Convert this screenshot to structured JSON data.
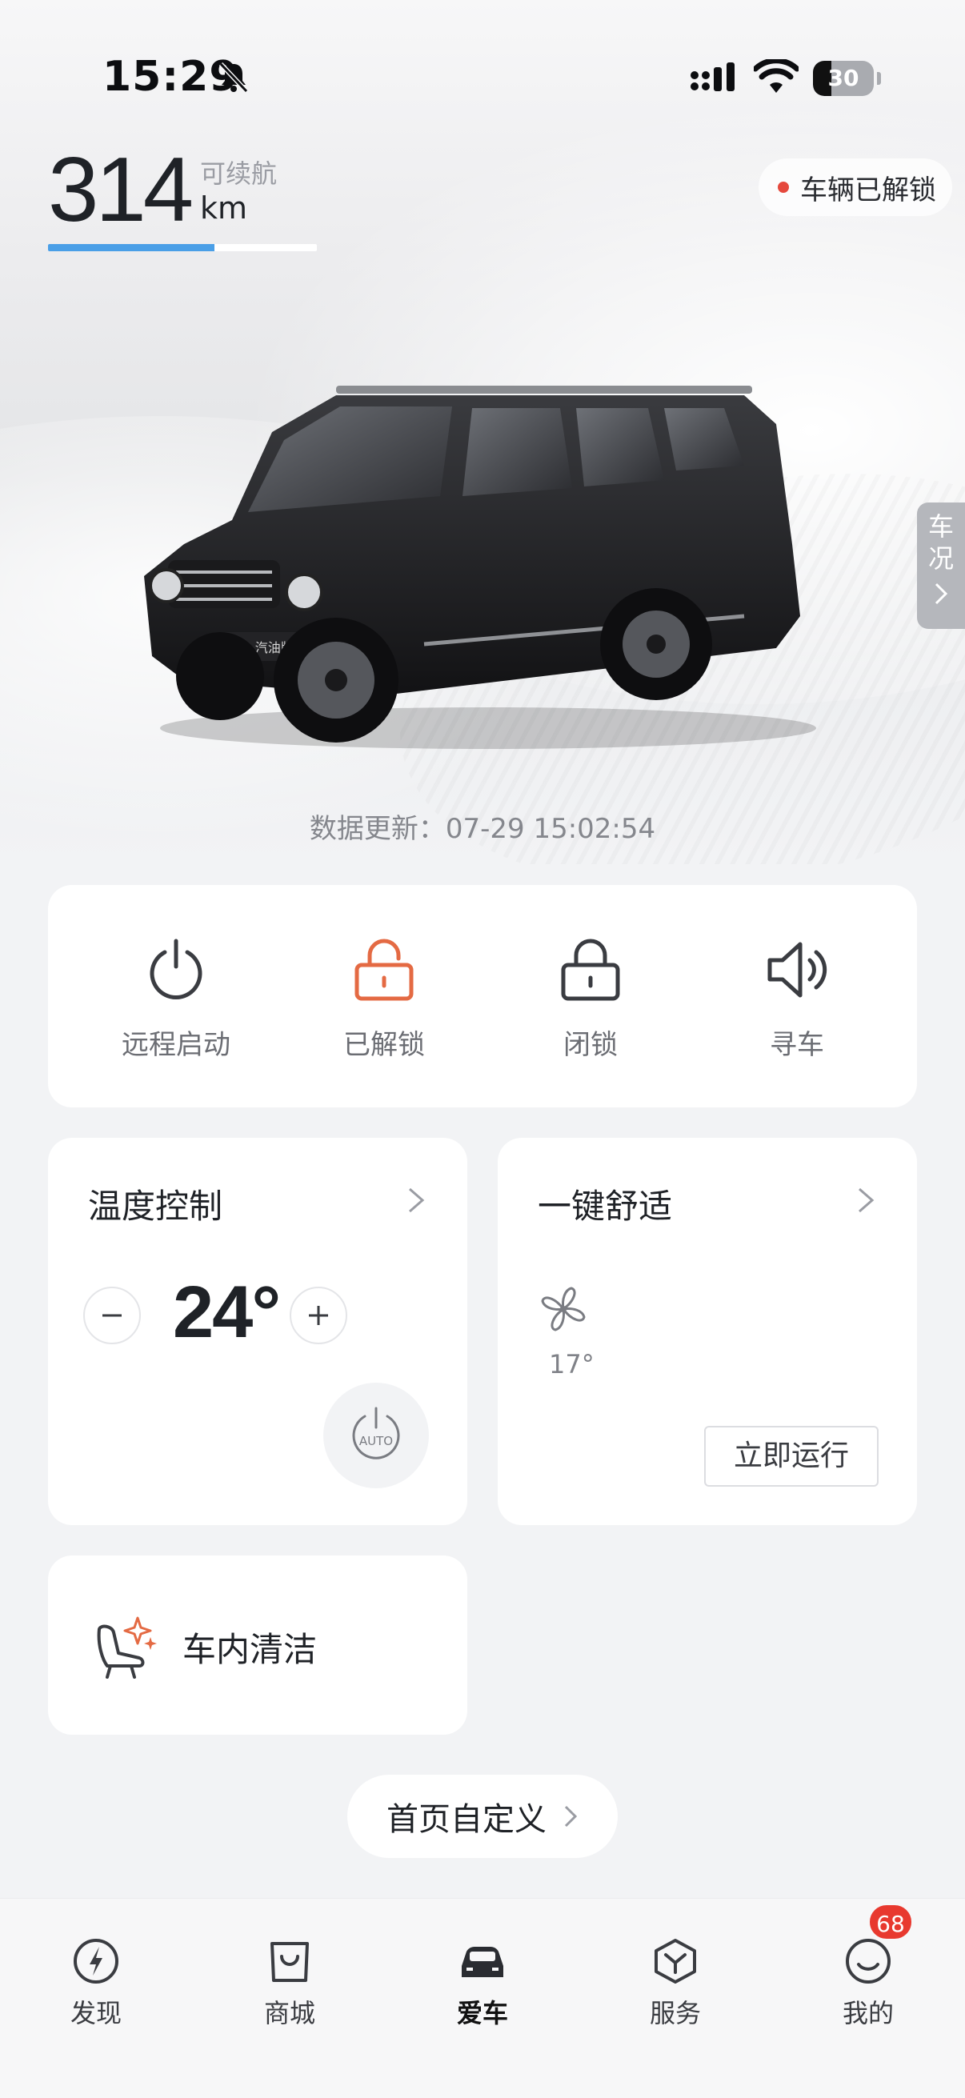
{
  "status_bar": {
    "time": "15:29",
    "battery_level": "30",
    "battery_fraction": 0.3
  },
  "range": {
    "value": "314",
    "label": "可续航",
    "unit": "km",
    "progress_fraction": 0.62
  },
  "lock_status": {
    "text": "车辆已解锁",
    "dot_color": "#e5483d"
  },
  "side_tab": {
    "chars": [
      "车",
      "况"
    ]
  },
  "vehicle": {
    "plate_text": "300 汽油版"
  },
  "update": {
    "text": "数据更新：07-29 15:02:54"
  },
  "controls": [
    {
      "label": "远程启动",
      "icon": "power-icon",
      "color": "#3a3c41"
    },
    {
      "label": "已解锁",
      "icon": "unlocked-icon",
      "color": "#e46a43"
    },
    {
      "label": "闭锁",
      "icon": "lock-icon",
      "color": "#3a3c41"
    },
    {
      "label": "寻车",
      "icon": "speaker-icon",
      "color": "#3a3c41"
    }
  ],
  "temperature": {
    "title": "温度控制",
    "value": "24°",
    "auto_label": "AUTO"
  },
  "comfort": {
    "title": "一键舒适",
    "fan_temp": "17°",
    "run_label": "立即运行"
  },
  "clean": {
    "label": "车内清洁"
  },
  "customize": {
    "label": "首页自定义"
  },
  "tabbar": {
    "items": [
      {
        "label": "发现",
        "icon": "lightning-icon"
      },
      {
        "label": "商城",
        "icon": "shopping-bag-icon"
      },
      {
        "label": "爱车",
        "icon": "car-icon",
        "active": true
      },
      {
        "label": "服务",
        "icon": "service-cube-icon"
      },
      {
        "label": "我的",
        "icon": "smile-icon"
      }
    ],
    "badge": "68"
  },
  "colors": {
    "accent_blue": "#4a9fe7",
    "unlock_orange": "#e46a43",
    "badge_red": "#e8392f"
  }
}
